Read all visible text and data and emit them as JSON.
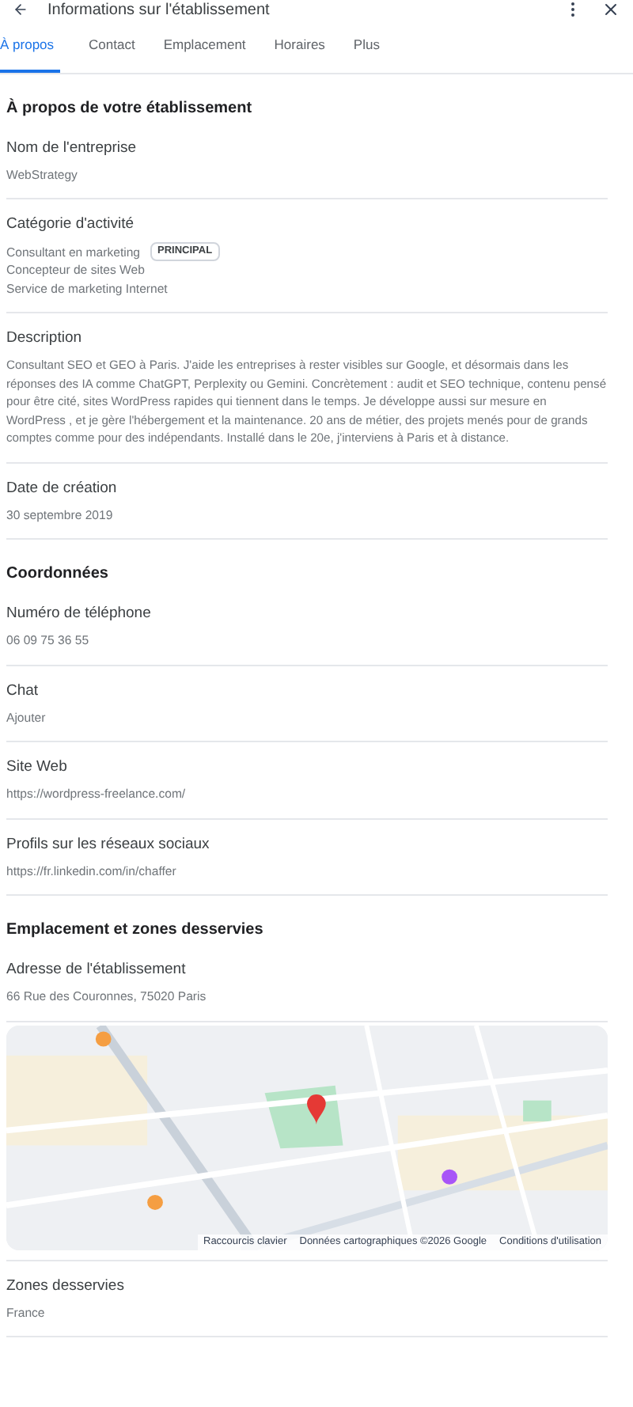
{
  "header": {
    "title": "Informations sur l'établissement"
  },
  "tabs": [
    {
      "label": "À propos",
      "selected": true
    },
    {
      "label": "Contact",
      "selected": false
    },
    {
      "label": "Emplacement",
      "selected": false
    },
    {
      "label": "Horaires",
      "selected": false
    },
    {
      "label": "Plus",
      "selected": false
    }
  ],
  "sections": [
    {
      "heading": "À propos de votre établissement",
      "fields": [
        {
          "kind": "text",
          "label": "Nom de l'entreprise",
          "values": [
            {
              "text": "WebStrategy"
            }
          ]
        },
        {
          "kind": "text",
          "label": "Catégorie d'activité",
          "values": [
            {
              "text": "Consultant en marketing",
              "badge": "PRINCIPAL"
            },
            {
              "text": "Concepteur de sites Web"
            },
            {
              "text": "Service de marketing Internet"
            }
          ]
        },
        {
          "kind": "paragraph",
          "label": "Description",
          "values": [
            {
              "text": "Consultant SEO et GEO à Paris. J'aide les entreprises à rester visibles sur Google, et désormais dans les réponses des IA comme ChatGPT, Perplexity ou Gemini. Concrètement : audit et SEO technique, contenu pensé pour être cité, sites WordPress rapides qui tiennent dans le temps. Je développe aussi sur mesure en WordPress , et je gère l'hébergement et la maintenance. 20 ans de métier, des projets menés pour de grands comptes comme pour des indépendants. Installé dans le 20e, j'interviens à Paris et à distance."
            }
          ]
        },
        {
          "kind": "text",
          "label": "Date de création",
          "values": [
            {
              "text": "30 septembre 2019"
            }
          ]
        }
      ]
    },
    {
      "heading": "Coordonnées",
      "fields": [
        {
          "kind": "text",
          "label": "Numéro de téléphone",
          "values": [
            {
              "text": "06 09 75 36 55"
            }
          ]
        },
        {
          "kind": "text",
          "label": "Chat",
          "values": [
            {
              "text": "Ajouter"
            }
          ]
        },
        {
          "kind": "text",
          "label": "Site Web",
          "values": [
            {
              "text": "https://wordpress-freelance.com/"
            }
          ]
        },
        {
          "kind": "text",
          "label": "Profils sur les réseaux sociaux",
          "values": [
            {
              "text": "https://fr.linkedin.com/in/chaffer"
            }
          ]
        }
      ]
    },
    {
      "heading": "Emplacement et zones desservies",
      "fields": [
        {
          "kind": "text",
          "label": "Adresse de l'établissement",
          "values": [
            {
              "text": "66 Rue des Couronnes, 75020 Paris"
            }
          ]
        },
        {
          "kind": "map",
          "attribution": [
            "Raccourcis clavier",
            "Données cartographiques ©2026 Google",
            "Conditions d'utilisation"
          ]
        },
        {
          "kind": "text",
          "label": "Zones desservies",
          "values": [
            {
              "text": "France"
            }
          ]
        }
      ]
    }
  ]
}
